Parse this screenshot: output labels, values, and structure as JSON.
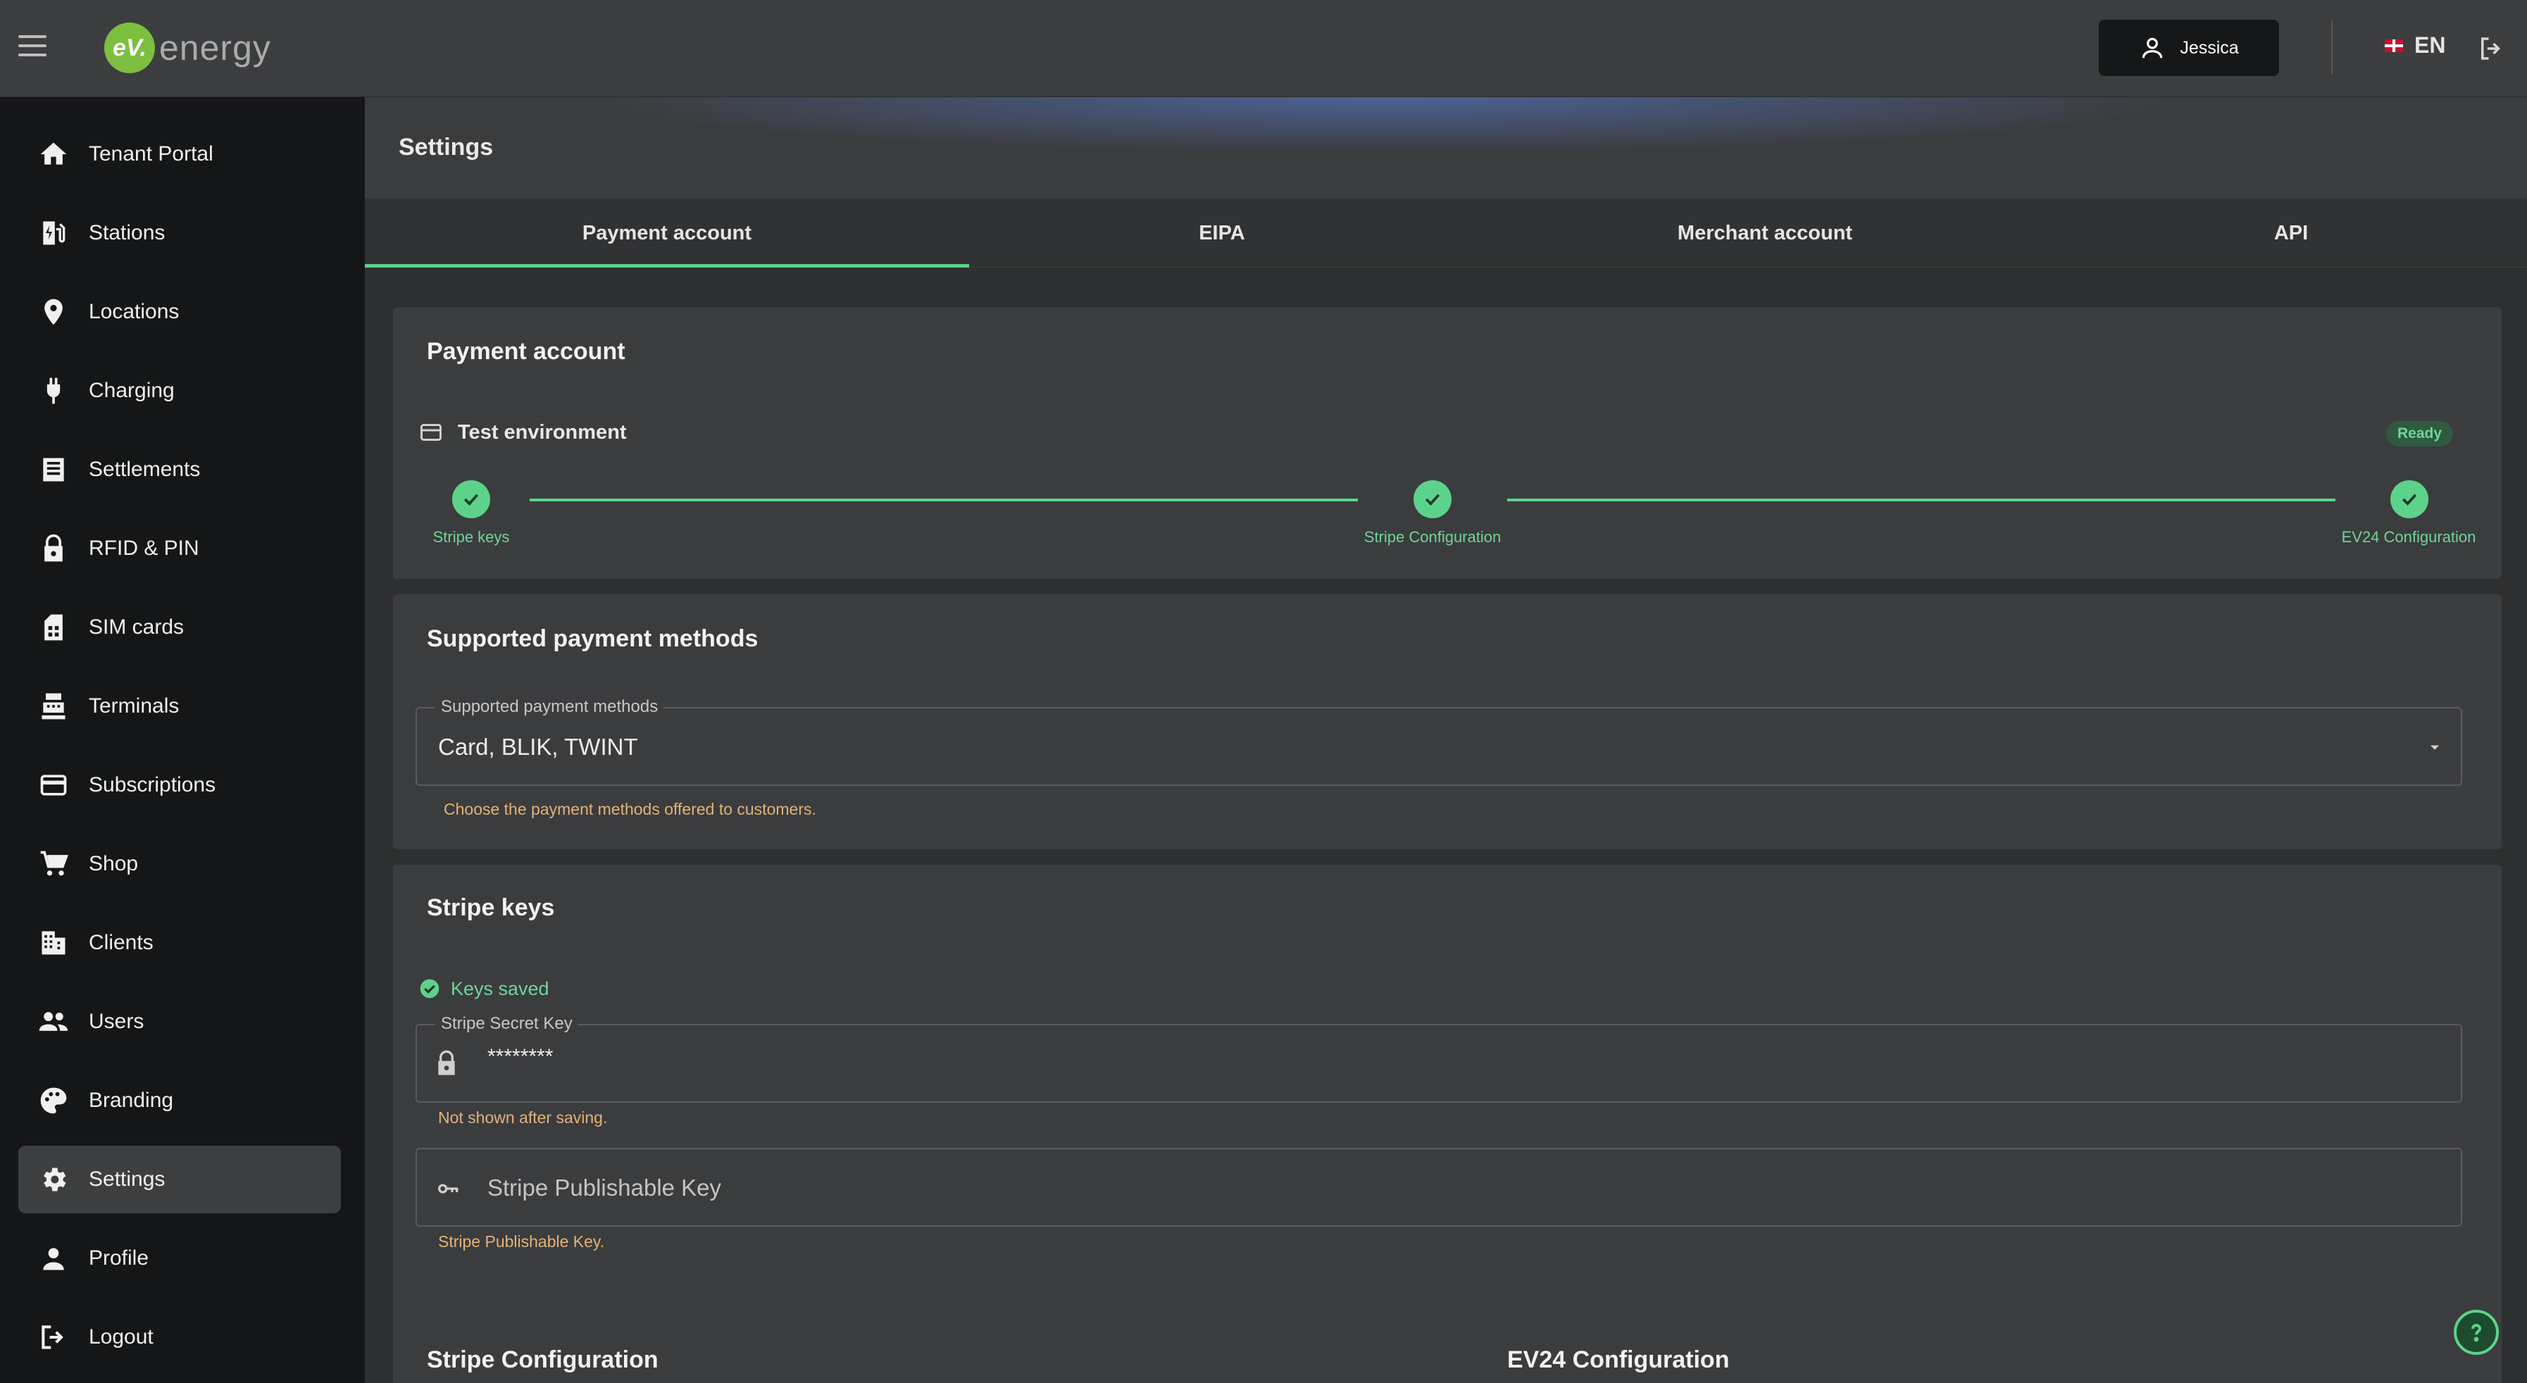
{
  "app": {
    "brand_prefix": "eV.",
    "brand_name": "energy",
    "user_name": "Jessica",
    "language": "EN"
  },
  "sidebar": {
    "items": [
      {
        "label": "Tenant Portal",
        "icon": "home-icon"
      },
      {
        "label": "Stations",
        "icon": "ev-station-icon"
      },
      {
        "label": "Locations",
        "icon": "location-pin-icon"
      },
      {
        "label": "Charging",
        "icon": "plug-icon"
      },
      {
        "label": "Settlements",
        "icon": "receipt-icon"
      },
      {
        "label": "RFID & PIN",
        "icon": "lock-icon"
      },
      {
        "label": "SIM cards",
        "icon": "sim-card-icon"
      },
      {
        "label": "Terminals",
        "icon": "terminal-icon"
      },
      {
        "label": "Subscriptions",
        "icon": "credit-card-icon"
      },
      {
        "label": "Shop",
        "icon": "cart-icon"
      },
      {
        "label": "Clients",
        "icon": "building-icon"
      },
      {
        "label": "Users",
        "icon": "people-icon"
      },
      {
        "label": "Branding",
        "icon": "palette-icon"
      },
      {
        "label": "Settings",
        "icon": "gear-icon",
        "active": true
      },
      {
        "label": "Profile",
        "icon": "person-icon"
      },
      {
        "label": "Logout",
        "icon": "logout-icon"
      }
    ]
  },
  "page": {
    "title": "Settings",
    "tabs": [
      "Payment account",
      "EIPA",
      "Merchant account",
      "API"
    ]
  },
  "payment_account": {
    "title": "Payment account",
    "environment": "Test environment",
    "status": "Ready",
    "steps": [
      "Stripe keys",
      "Stripe Configuration",
      "EV24 Configuration"
    ]
  },
  "payment_methods": {
    "title": "Supported payment methods",
    "field_label": "Supported payment methods",
    "value": "Card, BLIK, TWINT",
    "helper": "Choose the payment methods offered to customers."
  },
  "stripe_keys": {
    "title": "Stripe keys",
    "status": "Keys saved",
    "secret_label": "Stripe Secret Key",
    "secret_value": "********",
    "secret_helper": "Not shown after saving.",
    "publishable_placeholder": "Stripe Publishable Key",
    "publishable_helper": "Stripe Publishable Key."
  },
  "bottom_cards": {
    "stripe_config_title": "Stripe Configuration",
    "ev24_config_title": "EV24 Configuration"
  },
  "colors": {
    "accent": "#5dd28a",
    "helper_text": "#e0b37a",
    "sidebar_bg": "#141617"
  }
}
